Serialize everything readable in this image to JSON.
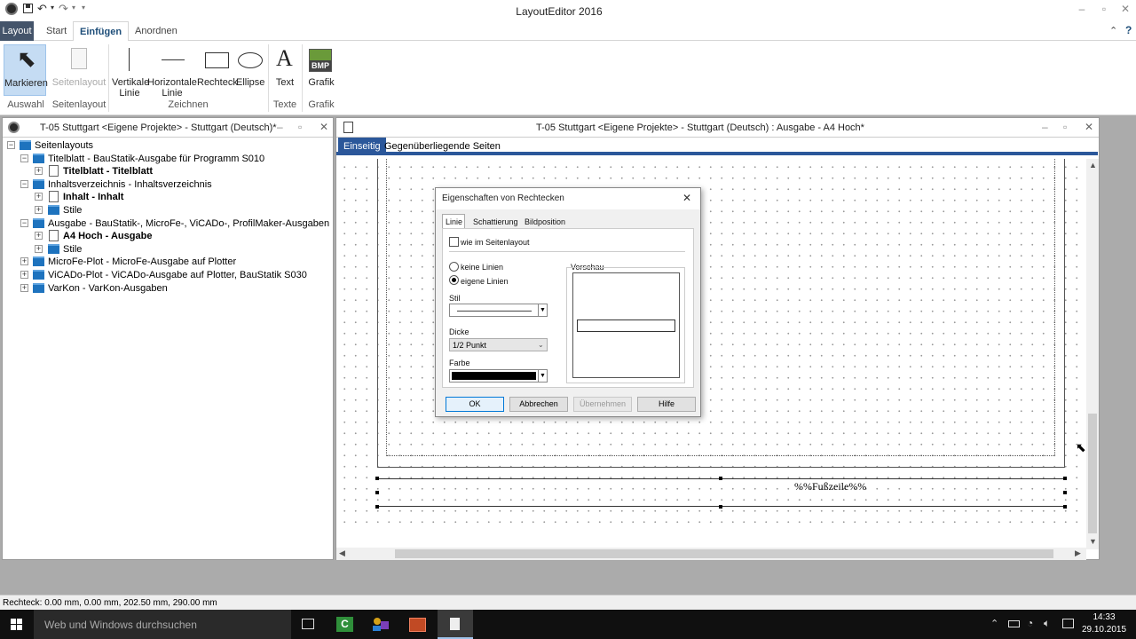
{
  "window": {
    "title": "LayoutEditor 2016"
  },
  "quick_access": {
    "save_icon": "save-icon",
    "undo_icon": "undo-icon",
    "redo_icon": "redo-icon"
  },
  "ribbon_tabs": [
    "Layout",
    "Start",
    "Einfügen",
    "Anordnen"
  ],
  "ribbon": {
    "buttons": {
      "markieren": "Markieren",
      "seitenlayout": "Seitenlayout",
      "vertikale": "Vertikale Linie",
      "horizontale": "Horizontale Linie",
      "rechteck": "Rechteck",
      "ellipse": "Ellipse",
      "text": "Text",
      "grafik": "Grafik",
      "bmp_badge": "BMP"
    },
    "groups": {
      "auswahl": "Auswahl",
      "seitenlayout": "Seitenlayout",
      "zeichnen": "Zeichnen",
      "texte": "Texte",
      "grafik": "Grafik"
    }
  },
  "left_pane": {
    "title": "T-05 Stuttgart <Eigene Projekte> - Stuttgart (Deutsch)*",
    "tree": [
      {
        "label": "Seitenlayouts",
        "bold": false
      },
      {
        "label": "Titelblatt - BauStatik-Ausgabe für Programm S010",
        "bold": false
      },
      {
        "label": "Titelblatt - Titelblatt",
        "bold": true
      },
      {
        "label": "Inhaltsverzeichnis - Inhaltsverzeichnis",
        "bold": false
      },
      {
        "label": "Inhalt - Inhalt",
        "bold": true
      },
      {
        "label": "Stile",
        "bold": false
      },
      {
        "label": "Ausgabe - BauStatik-, MicroFe-, ViCADo-, ProfilMaker-Ausgaben",
        "bold": false
      },
      {
        "label": "A4 Hoch - Ausgabe",
        "bold": true
      },
      {
        "label": "Stile",
        "bold": false
      },
      {
        "label": "MicroFe-Plot - MicroFe-Ausgabe auf Plotter",
        "bold": false
      },
      {
        "label": "ViCADo-Plot - ViCADo-Ausgabe auf Plotter, BauStatik S030",
        "bold": false
      },
      {
        "label": "VarKon - VarKon-Ausgaben",
        "bold": false
      }
    ]
  },
  "right_pane": {
    "title": "T-05 Stuttgart <Eigene Projekte> - Stuttgart (Deutsch) : Ausgabe - A4 Hoch*",
    "tabs": [
      "Einseitig",
      "Gegenüberliegende Seiten"
    ],
    "footer_placeholder": "%%Fußzeile%%"
  },
  "dialog": {
    "title": "Eigenschaften von Rechtecken",
    "tabs": [
      "Linie",
      "Schattierung",
      "Bildposition"
    ],
    "checkbox_label": "wie im Seitenlayout",
    "radio_none": "keine Linien",
    "radio_own": "eigene Linien",
    "stil_label": "Stil",
    "dicke_label": "Dicke",
    "dicke_value": "1/2 Punkt",
    "farbe_label": "Farbe",
    "farbe_value": "#000000",
    "vorschau_label": "Vorschau",
    "buttons": {
      "ok": "OK",
      "abbrechen": "Abbrechen",
      "uebernehmen": "Übernehmen",
      "hilfe": "Hilfe"
    }
  },
  "status_bar": "Rechteck: 0.00 mm, 0.00 mm, 202.50 mm, 290.00 mm",
  "taskbar": {
    "search_placeholder": "Web und Windows durchsuchen",
    "time": "14:33",
    "date": "29.10.2015"
  },
  "colors": {
    "accent": "#2b579a",
    "layout_tab": "#44546a",
    "taskbar": "#101010"
  }
}
